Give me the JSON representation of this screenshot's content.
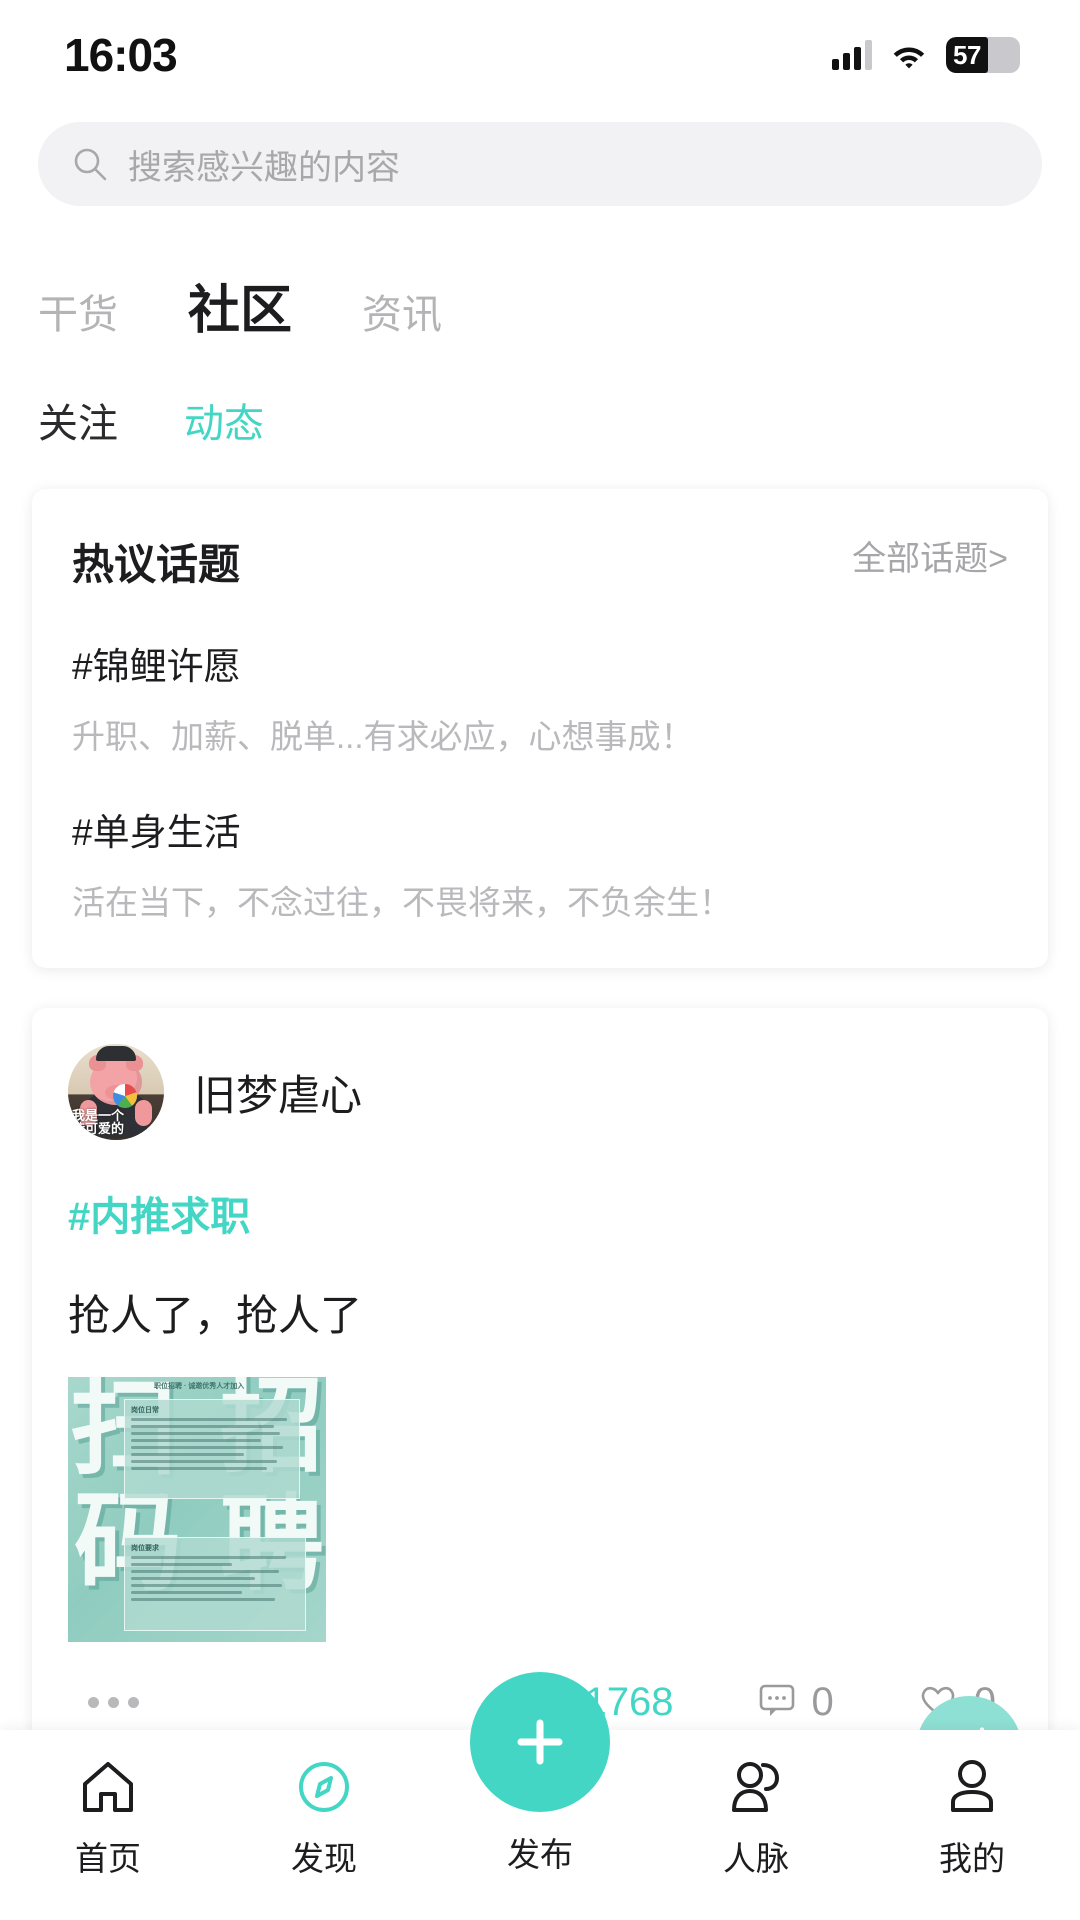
{
  "statusbar": {
    "time": "16:03",
    "battery_percent": "57",
    "signal_icon": "signal-bars-icon",
    "wifi_icon": "wifi-icon",
    "battery_icon": "battery-icon"
  },
  "search": {
    "placeholder": "搜索感兴趣的内容",
    "icon": "search-icon"
  },
  "main_tabs": [
    {
      "label": "干货",
      "active": false
    },
    {
      "label": "社区",
      "active": true
    },
    {
      "label": "资讯",
      "active": false
    }
  ],
  "sub_tabs": [
    {
      "label": "关注",
      "active": false
    },
    {
      "label": "动态",
      "active": true
    }
  ],
  "topic_card": {
    "title": "热议话题",
    "all_link": "全部话题>",
    "topics": [
      {
        "tag": "#锦鲤许愿",
        "desc": "升职、加薪、脱单...有求必应，心想事成！"
      },
      {
        "tag": "#单身生活",
        "desc": "活在当下，不念过往，不畏将来，不负余生！"
      }
    ]
  },
  "post": {
    "username": "旧梦虐心",
    "avatar_icon": "pig-avatar",
    "avatar_overlay_line1": "我是一个",
    "avatar_overlay_line2": "持可爱的",
    "hashtag": "#内推求职",
    "content": "抢人了，抢人了",
    "image": {
      "name": "recruitment-poster",
      "caption": "职位招聘 · 诚邀优秀人才加入",
      "big_char_left_top": "扫",
      "big_char_left_bottom": "码",
      "big_char_right_top": "招",
      "big_char_right_bottom": "聘",
      "box_top_title": "岗位日常",
      "box_bottom_title": "岗位要求"
    },
    "more_icon": "more-dots-icon",
    "stats": [
      {
        "icon": "eye-icon",
        "value": "1768",
        "highlight": true
      },
      {
        "icon": "comment-icon",
        "value": "0",
        "highlight": false
      },
      {
        "icon": "heart-icon",
        "value": "0",
        "highlight": false
      }
    ],
    "mini_fab_icon": "refresh-icon"
  },
  "bottom_nav": [
    {
      "label": "首页",
      "icon": "home-icon",
      "active": false
    },
    {
      "label": "发现",
      "icon": "compass-icon",
      "active": true
    },
    {
      "label": "发布",
      "icon": "plus-icon",
      "active": false
    },
    {
      "label": "人脉",
      "icon": "people-icon",
      "active": false
    },
    {
      "label": "我的",
      "icon": "person-icon",
      "active": false
    }
  ],
  "colors": {
    "accent": "#44d6c4",
    "accent_light": "#8fe0d4",
    "text_primary": "#1d1d1f",
    "text_muted": "#b9b9bc",
    "search_bg": "#f2f2f4"
  }
}
